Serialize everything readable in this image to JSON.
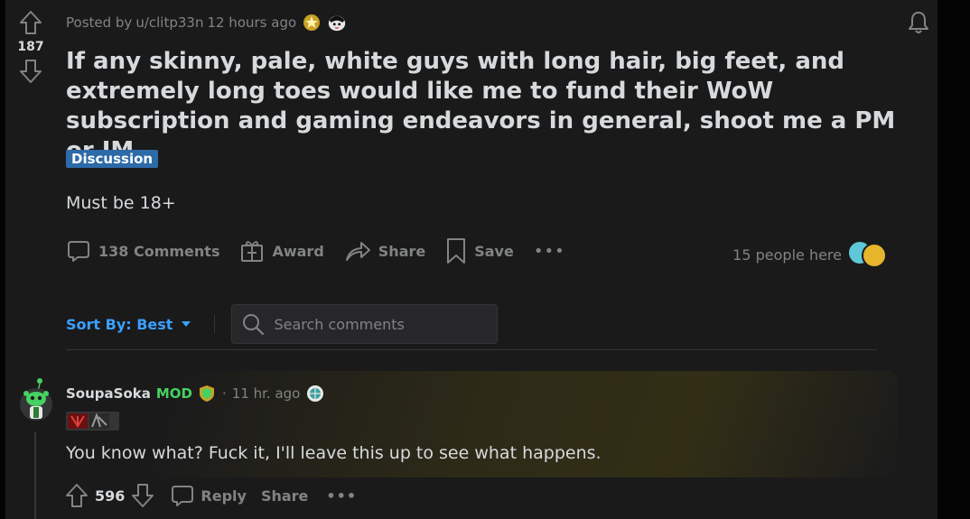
{
  "post": {
    "score": "187",
    "posted_by_prefix": "Posted by",
    "author": "u/clitp33n",
    "time": "12 hours ago",
    "title": "If any skinny, pale, white guys with long hair, big feet, and extremely long toes would like me to fund their WoW subscription and gaming endeavors in general, shoot me a PM or IM",
    "flair": "Discussion",
    "body": "Must be 18+",
    "actions": {
      "comments": "138 Comments",
      "award": "Award",
      "share": "Share",
      "save": "Save"
    },
    "people_here": "15 people here"
  },
  "sort": {
    "label": "Sort By: Best",
    "search_placeholder": "Search comments"
  },
  "comment": {
    "author": "SoupaSoka",
    "mod_badge": "MOD",
    "separator": "·",
    "time": "11 hr. ago",
    "text": "You know what? Fuck it, I'll leave this up to see what happens.",
    "score": "596",
    "reply": "Reply",
    "share": "Share"
  },
  "colors": {
    "background": "#1a1a1b",
    "page": "#030303",
    "text": "#d7dadc",
    "muted": "#818384",
    "flair": "#2d6aa8",
    "sort_blue": "#3aa0ff",
    "mod_green": "#46d160"
  },
  "icons": {
    "upvote": "upvote-arrow-icon",
    "downvote": "downvote-arrow-icon",
    "bell": "notification-bell-icon",
    "comment": "comment-bubble-icon",
    "award": "gift-award-icon",
    "share": "share-arrow-icon",
    "save": "bookmark-icon",
    "search": "search-icon"
  }
}
